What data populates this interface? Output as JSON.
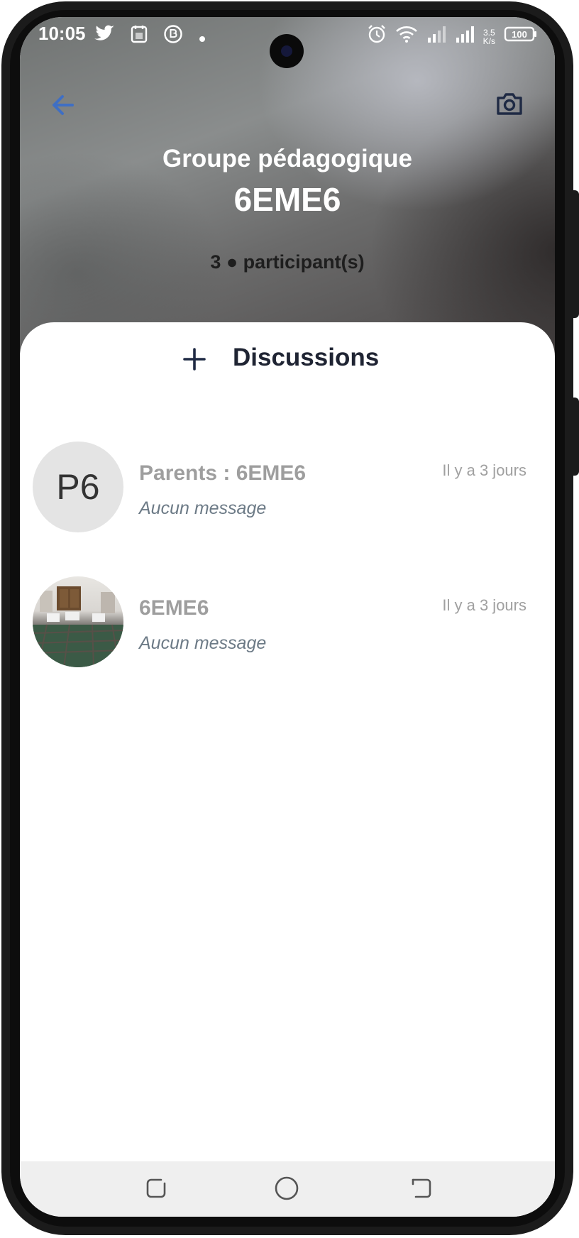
{
  "status_bar": {
    "time": "10:05",
    "left_icons": [
      "twitter-icon",
      "calendar-icon",
      "business-chat-icon",
      "dot-icon"
    ],
    "right_icons": [
      "alarm-icon",
      "wifi-icon",
      "signal-icon",
      "signal-icon",
      "speed-icon",
      "battery-icon"
    ],
    "speed_value": "3.5",
    "speed_unit": "K/s",
    "battery_level": "100"
  },
  "header": {
    "back_icon": "arrow-left-icon",
    "camera_icon": "camera-icon",
    "title": "Groupe pédagogique",
    "group_name": "6EME6",
    "participants": "3 ● participant(s)"
  },
  "discussions": {
    "add_icon": "plus-icon",
    "title": "Discussions",
    "items": [
      {
        "avatar_initials": "P6",
        "name": "Parents : 6EME6",
        "last_message": "Aucun message",
        "time": "Il y a 3 jours"
      },
      {
        "avatar_initials": "",
        "name": "6EME6",
        "last_message": "Aucun message",
        "time": "Il y a 3 jours"
      }
    ]
  },
  "nav_bar": {
    "icons": [
      "recent-apps-icon",
      "home-icon",
      "back-icon"
    ]
  },
  "colors": {
    "accent_blue": "#3f6fc4",
    "sheet_title": "#1f2433",
    "muted_text": "#9e9e9e",
    "message_text": "#6c7a86"
  }
}
